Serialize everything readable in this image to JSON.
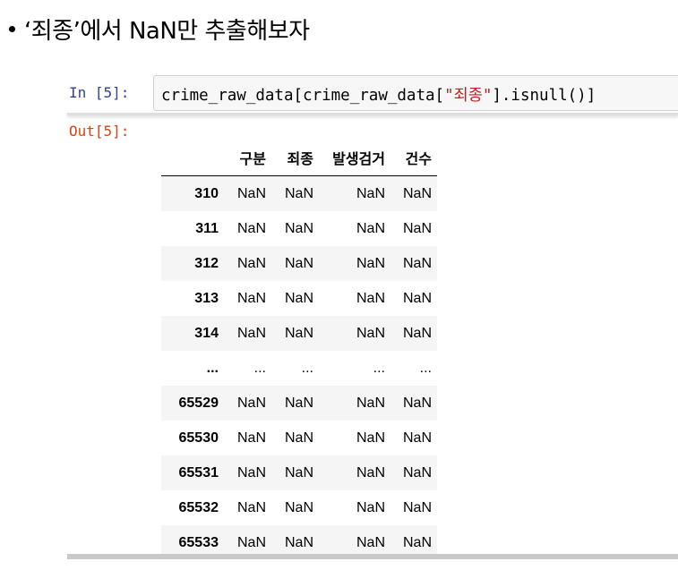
{
  "slide": {
    "bullet_text": "‘죄종’에서 NaN만 추출해보자"
  },
  "cell": {
    "in_prompt": "In [5]:",
    "out_prompt": "Out[5]:",
    "code": {
      "part1": "crime_raw_data[crime_raw_data[",
      "string_literal": "\"죄종\"",
      "part2": "].isnull()]"
    }
  },
  "dataframe": {
    "columns": [
      "구분",
      "죄종",
      "발생검거",
      "건수"
    ],
    "rows": [
      {
        "index": "310",
        "values": [
          "NaN",
          "NaN",
          "NaN",
          "NaN"
        ]
      },
      {
        "index": "311",
        "values": [
          "NaN",
          "NaN",
          "NaN",
          "NaN"
        ]
      },
      {
        "index": "312",
        "values": [
          "NaN",
          "NaN",
          "NaN",
          "NaN"
        ]
      },
      {
        "index": "313",
        "values": [
          "NaN",
          "NaN",
          "NaN",
          "NaN"
        ]
      },
      {
        "index": "314",
        "values": [
          "NaN",
          "NaN",
          "NaN",
          "NaN"
        ]
      },
      {
        "index": "...",
        "values": [
          "...",
          "...",
          "...",
          "..."
        ]
      },
      {
        "index": "65529",
        "values": [
          "NaN",
          "NaN",
          "NaN",
          "NaN"
        ]
      },
      {
        "index": "65530",
        "values": [
          "NaN",
          "NaN",
          "NaN",
          "NaN"
        ]
      },
      {
        "index": "65531",
        "values": [
          "NaN",
          "NaN",
          "NaN",
          "NaN"
        ]
      },
      {
        "index": "65532",
        "values": [
          "NaN",
          "NaN",
          "NaN",
          "NaN"
        ]
      },
      {
        "index": "65533",
        "values": [
          "NaN",
          "NaN",
          "NaN",
          "NaN"
        ]
      }
    ]
  }
}
